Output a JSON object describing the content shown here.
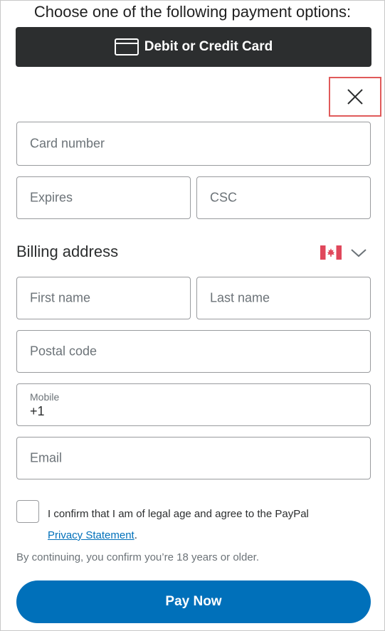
{
  "header": {
    "title": "Choose one of the following payment options:"
  },
  "payment_option": {
    "label": "Debit or Credit Card",
    "icon": "credit-card-icon"
  },
  "close": {
    "icon": "close-icon"
  },
  "card": {
    "number_placeholder": "Card number",
    "expires_placeholder": "Expires",
    "csc_placeholder": "CSC"
  },
  "billing": {
    "title": "Billing address",
    "country_flag": "canada-flag-icon",
    "first_name_placeholder": "First name",
    "last_name_placeholder": "Last name",
    "postal_code_placeholder": "Postal code",
    "mobile_label": "Mobile",
    "mobile_value": "+1",
    "email_placeholder": "Email"
  },
  "legal": {
    "confirm_text": "I confirm that I am of legal age and agree to the PayPal",
    "privacy_link": "Privacy Statement",
    "period": ".",
    "age_notice": "By continuing, you confirm you’re 18 years or older."
  },
  "pay_button": {
    "label": "Pay Now"
  },
  "colors": {
    "dark_button": "#2c2e2f",
    "accent_blue": "#0070ba",
    "highlight_red": "#e05a5a"
  }
}
